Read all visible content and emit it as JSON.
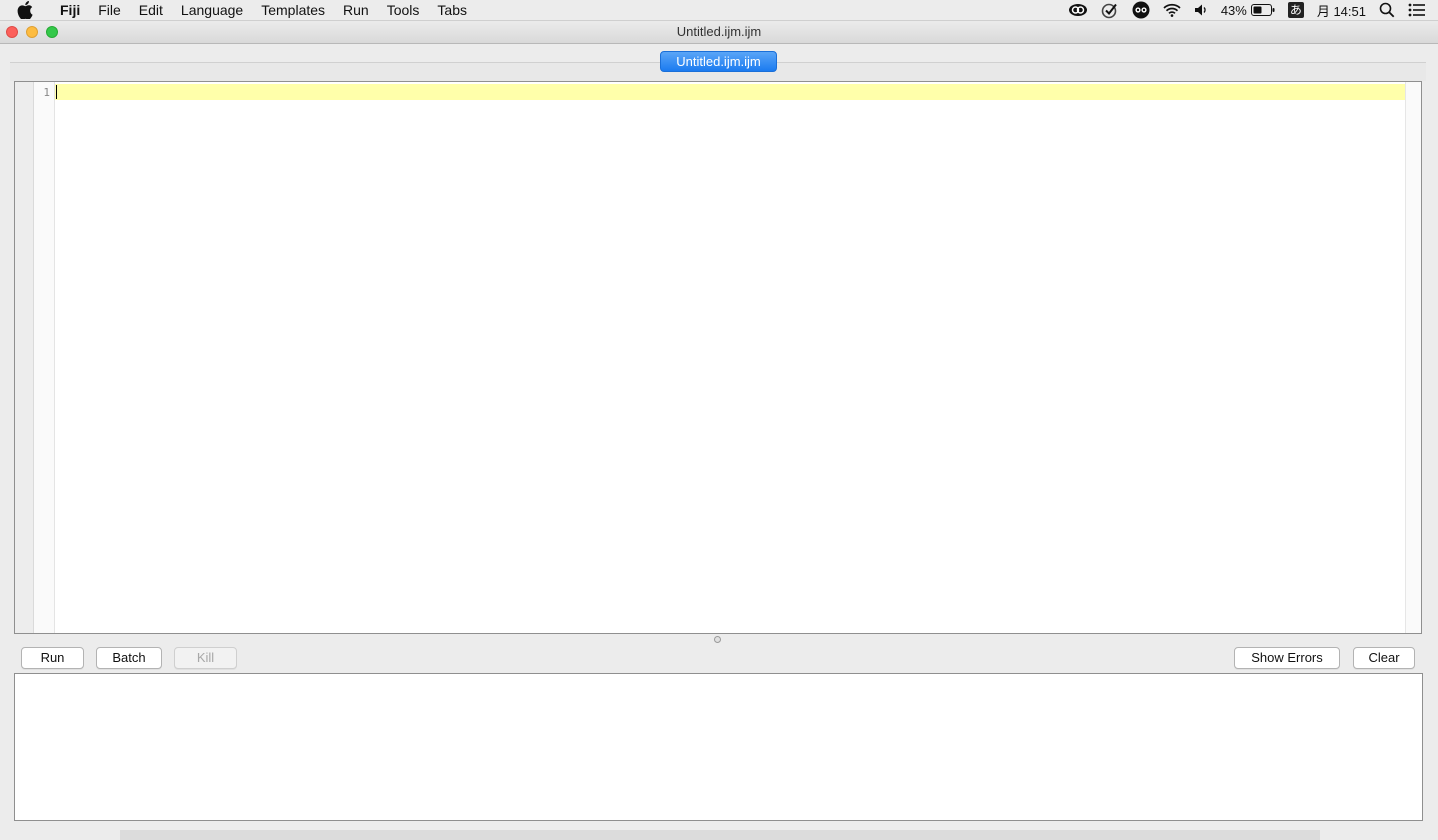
{
  "menubar": {
    "apple_icon": "apple-icon",
    "items": [
      "Fiji",
      "File",
      "Edit",
      "Language",
      "Templates",
      "Run",
      "Tools",
      "Tabs"
    ],
    "status": {
      "battery_percent": "43%",
      "input_method": "あ",
      "clock": "月 14:51",
      "icons": [
        "creative-cloud-icon",
        "checkmark-icon",
        "glasses-icon",
        "wifi-icon",
        "volume-icon",
        "battery-icon",
        "spotlight-icon",
        "notification-center-icon"
      ]
    }
  },
  "window": {
    "title": "Untitled.ijm.ijm",
    "traffic_lights": [
      "close",
      "minimize",
      "zoom"
    ]
  },
  "tabs": [
    {
      "label": "Untitled.ijm.ijm",
      "active": true
    }
  ],
  "editor": {
    "line_numbers": [
      "1"
    ],
    "current_line_color": "#ffffaa",
    "content": ""
  },
  "toolbar": {
    "run_label": "Run",
    "batch_label": "Batch",
    "kill_label": "Kill",
    "show_errors_label": "Show Errors",
    "clear_label": "Clear"
  },
  "output": {
    "content": ""
  },
  "colors": {
    "tab_active": "#1b7bf0",
    "close": "#fc605b",
    "minimize": "#fdbc40",
    "zoom": "#34c84a"
  }
}
